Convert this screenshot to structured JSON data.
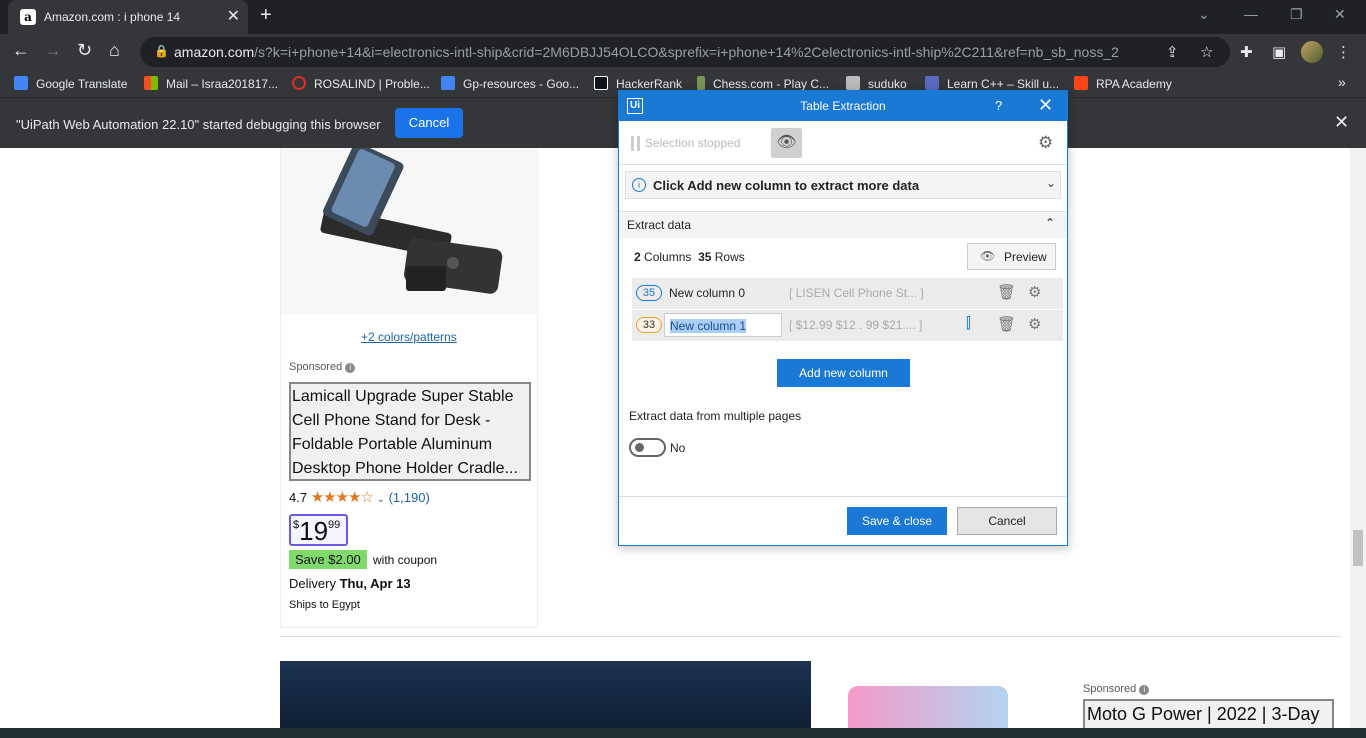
{
  "browser": {
    "tab_title": "Amazon.com : i phone 14",
    "favicon_letter": "a",
    "url_host": "amazon.com",
    "url_path": "/s?k=i+phone+14&i=electronics-intl-ship&crid=2M6DBJJ54OLCO&sprefix=i+phone+14%2Celectronics-intl-ship%2C211&ref=nb_sb_noss_2"
  },
  "bookmarks": [
    {
      "label": "Google Translate",
      "color": "#4285f4"
    },
    {
      "label": "Mail – Israa201817...",
      "color": "#f25022"
    },
    {
      "label": "ROSALIND | Proble...",
      "color": "#d93025"
    },
    {
      "label": "Gp-resources - Goo...",
      "color": "#4285f4"
    },
    {
      "label": "HackerRank",
      "color": "#0e141e"
    },
    {
      "label": "Chess.com - Play C...",
      "color": "#769656"
    },
    {
      "label": "suduko",
      "color": "#bbbbbb"
    },
    {
      "label": "Learn C++ – Skill u...",
      "color": "#5c6bc0"
    },
    {
      "label": "RPA Academy",
      "color": "#fa4616"
    }
  ],
  "infobar": {
    "message": "\"UiPath Web Automation 22.10\" started debugging this browser",
    "cancel_label": "Cancel"
  },
  "product": {
    "colors_link": "+2 colors/patterns",
    "sponsored": "Sponsored",
    "title": "Lamicall Upgrade Super Stable Cell Phone Stand for Desk - Foldable Portable Aluminum Desktop Phone Holder Cradle...",
    "rating": "4.7",
    "stars": "★★★★☆",
    "rating_count": "(1,190)",
    "price_symbol": "$",
    "price_whole": "19",
    "price_fraction": "99",
    "save_badge": "Save $2.00",
    "coupon_text": "with coupon",
    "delivery_label": "Delivery",
    "delivery_date": "Thu, Apr 13",
    "ships_to": "Ships to Egypt"
  },
  "product2": {
    "sponsored": "Sponsored",
    "title": "Moto G Power | 2022 | 3-Day"
  },
  "dialog": {
    "logo": "Ui",
    "title": "Table Extraction",
    "help": "?",
    "selection_status": "Selection stopped",
    "banner_text": "Click Add new column to extract more data",
    "section_title": "Extract data",
    "columns_count": "2",
    "columns_label": "Columns",
    "rows_count": "35",
    "rows_label": "Rows",
    "preview_label": "Preview",
    "columns": [
      {
        "badge": "35",
        "name": "New column 0",
        "preview": "[ LISEN Cell Phone St... ]",
        "badge_color": "#1b79d6"
      },
      {
        "badge": "33",
        "name": "New column 1",
        "preview": "[ $12.99 $12 . 99 $21.... ]",
        "badge_color": "#e8a23a"
      }
    ],
    "add_column_label": "Add new column",
    "multi_pages_label": "Extract data from multiple pages",
    "toggle_state": "No",
    "save_label": "Save & close",
    "cancel_label": "Cancel"
  }
}
